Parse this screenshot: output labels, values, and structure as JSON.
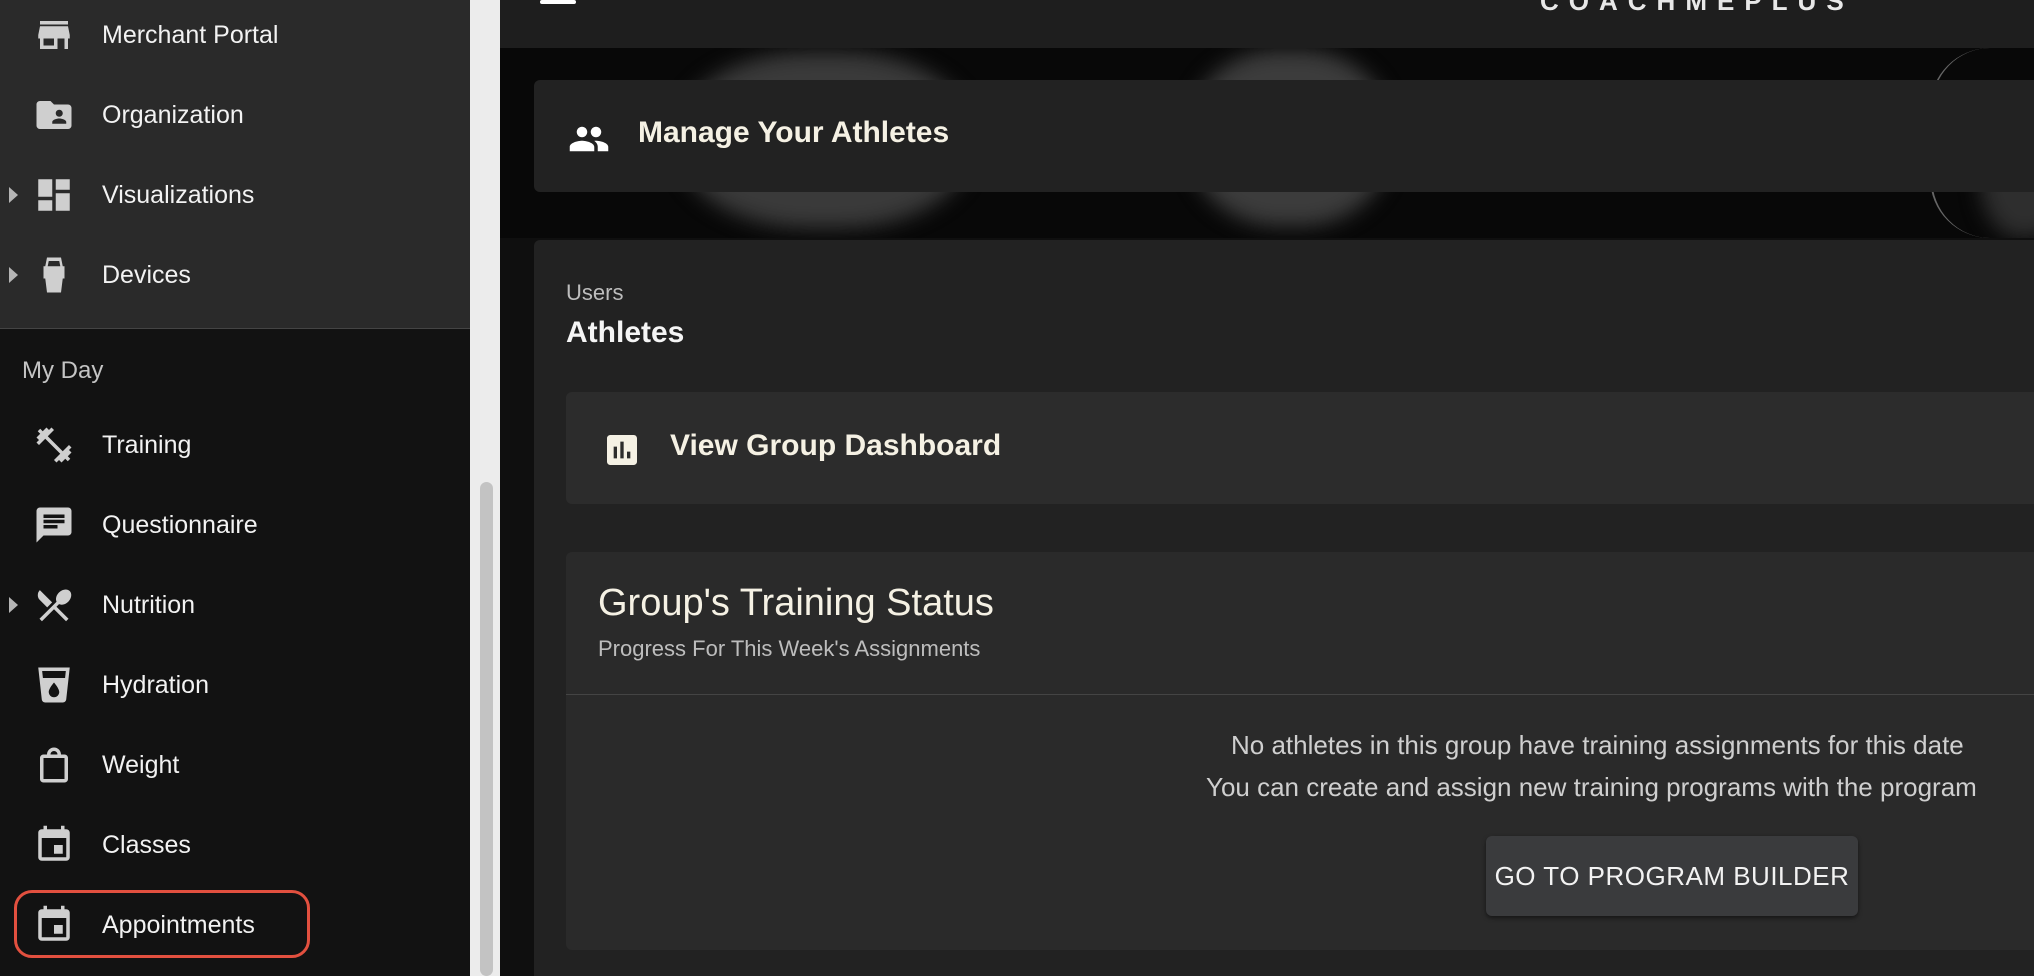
{
  "sidebar": {
    "admin_items": [
      {
        "label": "Merchant Portal",
        "icon": "storefront-icon",
        "expandable": false
      },
      {
        "label": "Organization",
        "icon": "folder-shared-icon",
        "expandable": false
      },
      {
        "label": "Visualizations",
        "icon": "dashboard-icon",
        "expandable": true
      },
      {
        "label": "Devices",
        "icon": "watch-band-icon",
        "expandable": true
      }
    ],
    "section_title": "My Day",
    "day_items": [
      {
        "label": "Training",
        "icon": "dumbbell-icon",
        "expandable": false
      },
      {
        "label": "Questionnaire",
        "icon": "chat-icon",
        "expandable": false
      },
      {
        "label": "Nutrition",
        "icon": "fork-spoon-icon",
        "expandable": true
      },
      {
        "label": "Hydration",
        "icon": "water-cup-icon",
        "expandable": false
      },
      {
        "label": "Weight",
        "icon": "scale-icon",
        "expandable": false
      },
      {
        "label": "Classes",
        "icon": "calendar-icon",
        "expandable": false
      },
      {
        "label": "Appointments",
        "icon": "calendar-event-icon",
        "expandable": false,
        "highlighted": true
      }
    ],
    "highlight_color": "#e2503f"
  },
  "topbar": {
    "menu_icon": "hamburger-icon",
    "logo_text": "COACHMEPLUS"
  },
  "manage_card": {
    "icon": "people-icon",
    "title": "Manage Your Athletes"
  },
  "users_panel": {
    "breadcrumb": "Users",
    "title": "Athletes",
    "group_dashboard": {
      "icon": "bar-chart-icon",
      "label": "View Group Dashboard"
    },
    "training_status": {
      "title": "Group's Training Status",
      "subtitle": "Progress For This Week's Assignments",
      "message_line1": "No athletes in this group have training assignments for this date",
      "message_line2": "You can create and assign new training programs with the program",
      "button_label": "GO TO PROGRAM BUILDER"
    }
  },
  "colors": {
    "sidebar_bg": "#121212",
    "admin_block_bg": "#2a2a2a",
    "card_bg": "#222222",
    "accent_text": "#f5f1e4"
  }
}
